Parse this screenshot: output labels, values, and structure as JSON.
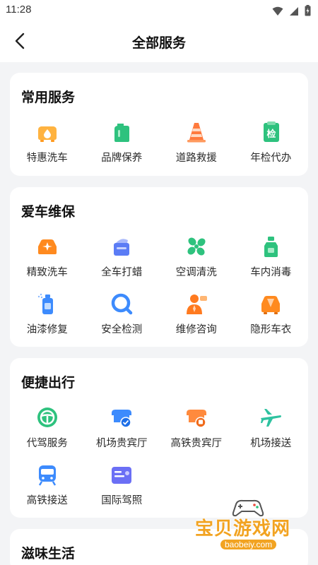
{
  "status_bar": {
    "time": "11:28",
    "icons": [
      "wifi-icon",
      "signal-icon",
      "battery-icon"
    ]
  },
  "header": {
    "title": "全部服务",
    "back_icon": "chevron-left-icon"
  },
  "sections": [
    {
      "title": "常用服务",
      "items": [
        {
          "label": "特惠洗车",
          "icon": "car-wash-icon",
          "color": "#ffa726"
        },
        {
          "label": "品牌保养",
          "icon": "oil-can-icon",
          "color": "#2ec27e"
        },
        {
          "label": "道路救援",
          "icon": "traffic-cone-icon",
          "color": "#ff7a3d"
        },
        {
          "label": "年检代办",
          "icon": "inspection-icon",
          "color": "#2ec27e"
        }
      ]
    },
    {
      "title": "爱车维保",
      "items": [
        {
          "label": "精致洗车",
          "icon": "car-sparkle-icon",
          "color": "#ff8a1f"
        },
        {
          "label": "全车打蜡",
          "icon": "wax-icon",
          "color": "#5b7cf5"
        },
        {
          "label": "空调清洗",
          "icon": "fan-icon",
          "color": "#2ec27e"
        },
        {
          "label": "车内消毒",
          "icon": "spray-bottle-icon",
          "color": "#2ec27e"
        },
        {
          "label": "油漆修复",
          "icon": "paint-spray-icon",
          "color": "#3d8bfd"
        },
        {
          "label": "安全检测",
          "icon": "magnifier-icon",
          "color": "#3d8bfd"
        },
        {
          "label": "维修咨询",
          "icon": "consultant-icon",
          "color": "#ff7a1f"
        },
        {
          "label": "隐形车衣",
          "icon": "car-cover-icon",
          "color": "#ff8a1f"
        }
      ]
    },
    {
      "title": "便捷出行",
      "items": [
        {
          "label": "代驾服务",
          "icon": "steering-wheel-icon",
          "color": "#2ec27e"
        },
        {
          "label": "机场贵宾厅",
          "icon": "vip-lounge-icon",
          "color": "#3d8bfd"
        },
        {
          "label": "高铁贵宾厅",
          "icon": "rail-lounge-icon",
          "color": "#ff8a3d"
        },
        {
          "label": "机场接送",
          "icon": "airplane-icon",
          "color": "#2ec2a0"
        },
        {
          "label": "高铁接送",
          "icon": "train-icon",
          "color": "#3d8bfd"
        },
        {
          "label": "国际驾照",
          "icon": "license-card-icon",
          "color": "#6b6ff5"
        }
      ]
    },
    {
      "title": "滋味生活",
      "items": []
    }
  ],
  "watermark": {
    "title": "宝贝游戏网",
    "url": "baobeiy.com",
    "icon": "gamepad-icon"
  }
}
